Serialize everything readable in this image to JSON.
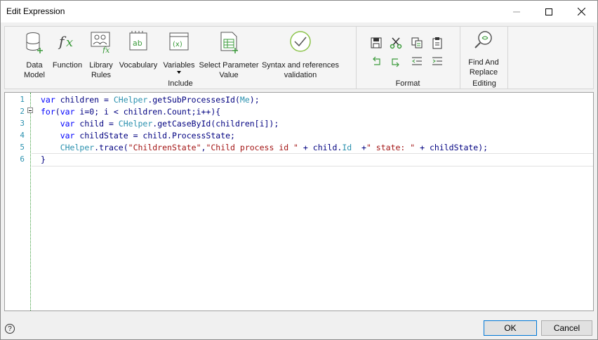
{
  "window": {
    "title": "Edit Expression"
  },
  "ribbon": {
    "include": {
      "label": "Include",
      "buttons": [
        {
          "label": "Data Model"
        },
        {
          "label": "Function"
        },
        {
          "label": "Library Rules"
        },
        {
          "label": "Vocabulary"
        },
        {
          "label": "Variables"
        },
        {
          "label": "Select Parameter Value"
        },
        {
          "label": "Syntax and references validation"
        }
      ]
    },
    "format": {
      "label": "Format"
    },
    "editing": {
      "label": "Editing",
      "find_label": "Find And Replace"
    }
  },
  "editor": {
    "line_numbers": [
      "1",
      "2",
      "3",
      "4",
      "5",
      "6"
    ],
    "lines": [
      "var children = CHelper.getSubProcessesId(Me);",
      "for(var i=0; i < children.Count;i++){",
      "    var child = CHelper.getCaseById(children[i]);",
      "    var childState = child.ProcessState;",
      "    CHelper.trace(\"ChildrenState\",\"Child process id \" + child.Id  +\" state: \" + childState);",
      "}"
    ]
  },
  "footer": {
    "ok_label": "OK",
    "cancel_label": "Cancel",
    "help_label": "?"
  },
  "colors": {
    "keyword": "#0000ff",
    "class": "#2b91af",
    "string": "#a31515",
    "line_number": "#2b91af"
  }
}
